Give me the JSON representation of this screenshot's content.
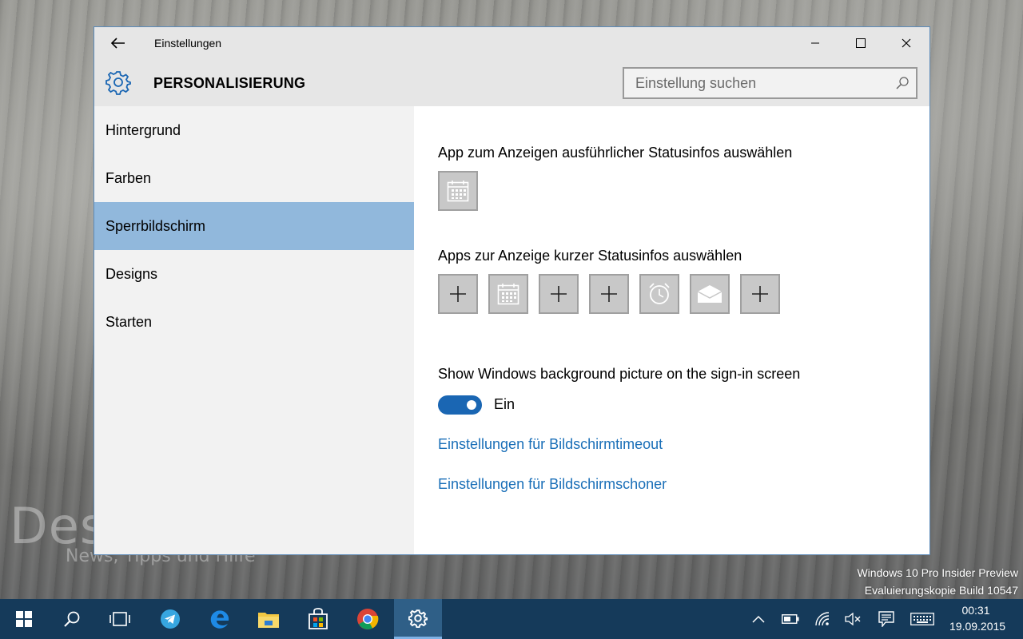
{
  "window": {
    "title": "Einstellungen",
    "section_title": "PERSONALISIERUNG",
    "search_placeholder": "Einstellung suchen"
  },
  "sidebar": {
    "items": [
      {
        "label": "Hintergrund",
        "selected": false
      },
      {
        "label": "Farben",
        "selected": false
      },
      {
        "label": "Sperrbildschirm",
        "selected": true
      },
      {
        "label": "Designs",
        "selected": false
      },
      {
        "label": "Starten",
        "selected": false
      }
    ]
  },
  "content": {
    "detailed_status_label": "App zum Anzeigen ausführlicher Statusinfos auswählen",
    "detailed_status_app": "calendar-icon",
    "quick_status_label": "Apps zur Anzeige kurzer Statusinfos auswählen",
    "quick_status_apps": [
      "plus-icon",
      "calendar-icon",
      "plus-icon",
      "plus-icon",
      "alarm-icon",
      "mail-icon",
      "plus-icon"
    ],
    "signin_bg_label": "Show Windows background picture on the sign-in screen",
    "signin_bg_toggle_state": "Ein",
    "signin_bg_toggle_on": true,
    "link_timeout": "Einstellungen für Bildschirmtimeout",
    "link_screensaver": "Einstellungen für Bildschirmschoner"
  },
  "desktop": {
    "watermark_title": "Deskmodder.de",
    "watermark_subtitle": "News, Tipps und Hilfe",
    "build_line1": "Windows 10 Pro Insider Preview",
    "build_line2": "Evaluierungskopie Build 10547"
  },
  "taskbar": {
    "apps": [
      "start-icon",
      "search-icon",
      "task-view-icon",
      "telegram-icon",
      "edge-icon",
      "file-explorer-icon",
      "store-icon",
      "chrome-icon",
      "settings-icon"
    ],
    "active_app": "settings-icon",
    "time": "00:31",
    "date": "19.09.2015"
  },
  "colors": {
    "accent": "#1a66b3",
    "selected_nav": "#91b8dc",
    "link": "#1a6fb8",
    "taskbar": "#153a5a"
  }
}
